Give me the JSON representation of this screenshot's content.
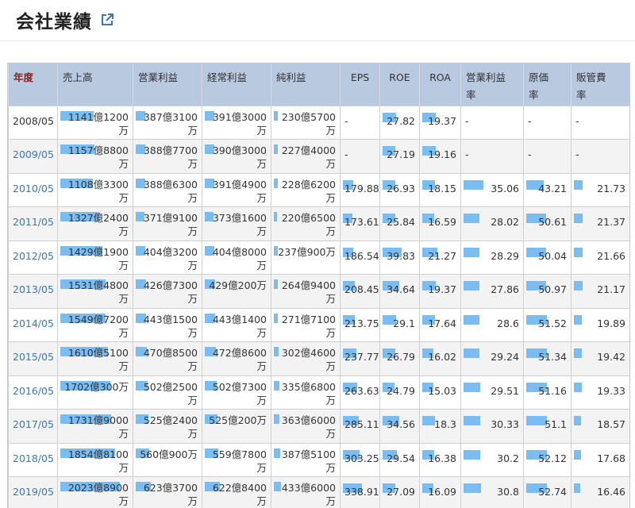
{
  "page": {
    "title": "会社業績",
    "link_icon": "external-link-icon"
  },
  "table": {
    "headers": [
      {
        "l1": "年度",
        "l2": ""
      },
      {
        "l1": "売上高",
        "l2": ""
      },
      {
        "l1": "営業利益",
        "l2": ""
      },
      {
        "l1": "経常利益",
        "l2": ""
      },
      {
        "l1": "純利益",
        "l2": ""
      },
      {
        "l1": "EPS",
        "l2": ""
      },
      {
        "l1": "ROE",
        "l2": ""
      },
      {
        "l1": "ROA",
        "l2": ""
      },
      {
        "l1": "営業利益",
        "l2": "率"
      },
      {
        "l1": "原価",
        "l2": "率"
      },
      {
        "l1": "販管費",
        "l2": "率"
      }
    ],
    "rows": [
      {
        "year": "2008/05",
        "link": false,
        "sales": [
          "1141億1200",
          "万"
        ],
        "op": [
          "387億3100",
          "万"
        ],
        "ord": [
          "391億3000",
          "万"
        ],
        "net": [
          "230億5700",
          "万"
        ],
        "eps": "-",
        "roe": "27.82",
        "roa": "19.37",
        "opm": "-",
        "cost": "-",
        "sga": "-"
      },
      {
        "year": "2009/05",
        "link": true,
        "sales": [
          "1157億8800",
          "万"
        ],
        "op": [
          "388億7700",
          "万"
        ],
        "ord": [
          "390億3000",
          "万"
        ],
        "net": [
          "227億4000",
          "万"
        ],
        "eps": "-",
        "roe": "27.19",
        "roa": "19.16",
        "opm": "-",
        "cost": "-",
        "sga": "-"
      },
      {
        "year": "2010/05",
        "link": true,
        "sales": [
          "1108億3300",
          "万"
        ],
        "op": [
          "388億6300",
          "万"
        ],
        "ord": [
          "391億4900",
          "万"
        ],
        "net": [
          "228億6200",
          "万"
        ],
        "eps": "179.88",
        "roe": "26.93",
        "roa": "18.15",
        "opm": "35.06",
        "cost": "43.21",
        "sga": "21.73"
      },
      {
        "year": "2011/05",
        "link": true,
        "sales": [
          "1327億2400",
          "万"
        ],
        "op": [
          "371億9100",
          "万"
        ],
        "ord": [
          "373億1600",
          "万"
        ],
        "net": [
          "220億6500",
          "万"
        ],
        "eps": "173.61",
        "roe": "25.84",
        "roa": "16.59",
        "opm": "28.02",
        "cost": "50.61",
        "sga": "21.37"
      },
      {
        "year": "2012/05",
        "link": true,
        "sales": [
          "1429億1900",
          "万"
        ],
        "op": [
          "404億3200",
          "万"
        ],
        "ord": [
          "404億8000",
          "万"
        ],
        "net": [
          "237億900万",
          ""
        ],
        "eps": "186.54",
        "roe": "39.83",
        "roa": "21.27",
        "opm": "28.29",
        "cost": "50.04",
        "sga": "21.66"
      },
      {
        "year": "2013/05",
        "link": true,
        "sales": [
          "1531億4800",
          "万"
        ],
        "op": [
          "426億7300",
          "万"
        ],
        "ord": [
          "429億200万",
          ""
        ],
        "net": [
          "264億9400",
          "万"
        ],
        "eps": "208.45",
        "roe": "34.64",
        "roa": "19.37",
        "opm": "27.86",
        "cost": "50.97",
        "sga": "21.17"
      },
      {
        "year": "2014/05",
        "link": true,
        "sales": [
          "1549億7200",
          "万"
        ],
        "op": [
          "443億1500",
          "万"
        ],
        "ord": [
          "443億1400",
          "万"
        ],
        "net": [
          "271億7100",
          "万"
        ],
        "eps": "213.75",
        "roe": "29.1",
        "roa": "17.64",
        "opm": "28.6",
        "cost": "51.52",
        "sga": "19.89"
      },
      {
        "year": "2015/05",
        "link": true,
        "sales": [
          "1610億5100",
          "万"
        ],
        "op": [
          "470億8500",
          "万"
        ],
        "ord": [
          "472億8600",
          "万"
        ],
        "net": [
          "302億4600",
          "万"
        ],
        "eps": "237.77",
        "roe": "26.79",
        "roa": "16.02",
        "opm": "29.24",
        "cost": "51.34",
        "sga": "19.42"
      },
      {
        "year": "2016/05",
        "link": true,
        "sales": [
          "1702億300万",
          ""
        ],
        "op": [
          "502億2500",
          "万"
        ],
        "ord": [
          "502億7300",
          "万"
        ],
        "net": [
          "335億6800",
          "万"
        ],
        "eps": "263.63",
        "roe": "24.79",
        "roa": "15.03",
        "opm": "29.51",
        "cost": "51.16",
        "sga": "19.33"
      },
      {
        "year": "2017/05",
        "link": true,
        "sales": [
          "1731億9000",
          "万"
        ],
        "op": [
          "525億2400",
          "万"
        ],
        "ord": [
          "525億200万",
          ""
        ],
        "net": [
          "363億6000",
          "万"
        ],
        "eps": "285.11",
        "roe": "34.56",
        "roa": "18.3",
        "opm": "30.33",
        "cost": "51.1",
        "sga": "18.57"
      },
      {
        "year": "2018/05",
        "link": true,
        "sales": [
          "1854億8100",
          "万"
        ],
        "op": [
          "560億900万",
          ""
        ],
        "ord": [
          "559億7800",
          "万"
        ],
        "net": [
          "387億5100",
          "万"
        ],
        "eps": "303.25",
        "roe": "29.54",
        "roa": "16.38",
        "opm": "30.2",
        "cost": "52.12",
        "sga": "17.68"
      },
      {
        "year": "2019/05",
        "link": true,
        "sales": [
          "2023億8900",
          "万"
        ],
        "op": [
          "623億3700",
          "万"
        ],
        "ord": [
          "622億8400",
          "万"
        ],
        "net": [
          "433億6000",
          "万"
        ],
        "eps": "338.91",
        "roe": "27.09",
        "roa": "16.09",
        "opm": "30.8",
        "cost": "52.74",
        "sga": "16.46"
      }
    ],
    "bar_color": "#79bdf2",
    "header_bg": "#b9c9df",
    "link_color": "#3a76b8"
  }
}
